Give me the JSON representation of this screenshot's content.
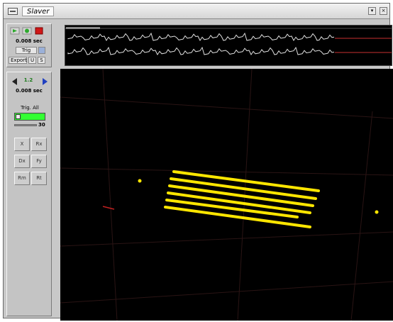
{
  "window": {
    "title": "Slaver"
  },
  "titlebar": {
    "menu_glyph": "▾",
    "close_glyph": "×"
  },
  "top_panel": {
    "time_value": "0.008 sec",
    "mode_select": "Trig",
    "export_label": "Export",
    "export_btn_a": "U",
    "export_btn_b": "S"
  },
  "mid_panel": {
    "nav_value": "1.2",
    "time_value": "0.008 sec",
    "trig_label": "Trig. All",
    "slider_value": "30"
  },
  "tool_grid": [
    {
      "label": "X",
      "name": "tool-x-button"
    },
    {
      "label": "Rx",
      "name": "tool-rx-button"
    },
    {
      "label": "Dx",
      "name": "tool-dx-button"
    },
    {
      "label": "Fy",
      "name": "tool-fy-button"
    },
    {
      "label": "Rm",
      "name": "tool-rm-button"
    },
    {
      "label": "Rt",
      "name": "tool-rt-button"
    }
  ],
  "colors": {
    "accent_green": "#2eaa2e",
    "status_red": "#d01818",
    "trig_green": "#33ff33",
    "marker_yellow": "#ffe600",
    "waveform": "#e0e0e0",
    "wave_ref": "#c83030",
    "viewport_grid": "#2a1414"
  },
  "icons": {
    "play": "play-icon",
    "record": "record-icon",
    "stop": "stop-icon",
    "step_back": "step-back-icon",
    "step_forward": "step-forward-icon",
    "menu": "window-menu-icon"
  }
}
